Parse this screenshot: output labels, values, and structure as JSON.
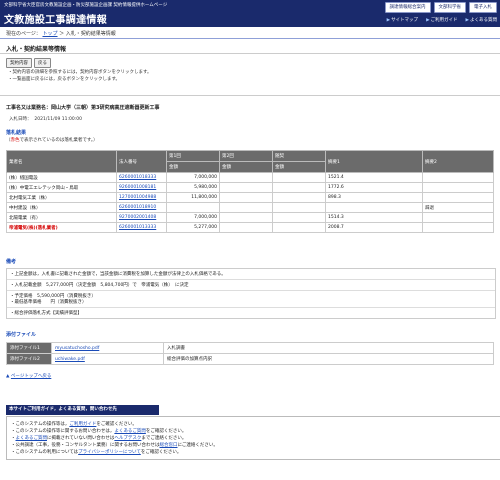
{
  "header": {
    "subtitle": "文部科学省大臣官房文教施設企画・防災部施設企画課 契約情報提供ホームページ",
    "title": "文教施設工事調達情報",
    "buttons": [
      "調達情報総合案内",
      "文部科学省",
      "電子入札"
    ],
    "links": [
      "サイトマップ",
      "ご利用ガイド",
      "よくある質問"
    ]
  },
  "breadcrumb": {
    "prefix": "現在のページ：",
    "top": "トップ",
    "sep1": "＞",
    "current": "入札・契約結果等情報"
  },
  "page_title": "入札・契約結果等情報",
  "controls": {
    "detail_btn": "契約内容",
    "return_btn": "戻る"
  },
  "notes": [
    "・契約内容の詳細を参照するには，契約内容ボタンをクリックします。",
    "・一覧画面に戻るには，戻るボタンをクリックします。"
  ],
  "work": {
    "name_label": "工事名又は業務名：",
    "name": "岡山大学（三朝）第3研究病高圧遮断器更新工事",
    "date_label": "入札日時：",
    "date": "2021/11/09 11:00:00"
  },
  "results": {
    "title": "落札結果",
    "legend_pre": "（",
    "legend_red": "赤色",
    "legend_post": "で表示されているのは落札業者です。）",
    "headers": [
      "業者名",
      "法人番号",
      "第1回",
      "第2回",
      "随契",
      "摘要1",
      "摘要2"
    ],
    "subheaders": [
      "金額",
      "金額",
      "金額"
    ],
    "rows": [
      {
        "name": "(株）楢国電設",
        "corp": "6260001018333",
        "r1": "7,000,000",
        "r2": "",
        "rz": "",
        "m1": "1521.4",
        "m2": "",
        "win": false
      },
      {
        "name": "(株）中電工エレテック岡山・鳥取",
        "corp": "9260001008181",
        "r1": "5,980,000",
        "r2": "",
        "rz": "",
        "m1": "1772.6",
        "m2": "",
        "win": false
      },
      {
        "name": "北村電気工業（株）",
        "corp": "1270001004988",
        "r1": "11,800,000",
        "r2": "",
        "rz": "",
        "m1": "898.3",
        "m2": "",
        "win": false
      },
      {
        "name": "中村建設（株）",
        "corp": "6260001018910",
        "r1": "",
        "r2": "",
        "rz": "",
        "m1": "",
        "m2": "辞退",
        "win": false
      },
      {
        "name": "北陽電業（有）",
        "corp": "9270002001408",
        "r1": "7,000,000",
        "r2": "",
        "rz": "",
        "m1": "1514.3",
        "m2": "",
        "win": false
      },
      {
        "name": "帝浦電気(株)(落札業者)",
        "corp": "6260001013333",
        "r1": "5,277,000",
        "r2": "",
        "rz": "",
        "m1": "2008.7",
        "m2": "",
        "win": true
      }
    ]
  },
  "remarks": {
    "title": "備考",
    "lines": [
      "・上記金額は，入札書に記載された金額で，当該金額に消費税を加算した金額が法律上の入札価格である。",
      "・入札記載金額　5,277,000円（決定金額　5,804,700円）で　帝浦電気（株）　に決定",
      "・予定価格　5,590,000円（消費税抜き）\n・最低基準価格　　円（消費税抜き）",
      "・総合評価落札方式【実績評価型】"
    ]
  },
  "files": {
    "title": "添付ファイル",
    "rows": [
      {
        "label": "添付ファイル1",
        "file": "myusatuchosho.pdf",
        "desc": "入札調書"
      },
      {
        "label": "添付ファイル2",
        "file": "uchiwake.pdf",
        "desc": "総合評価の加算点内訳"
      }
    ]
  },
  "page_top": "ページトップへ戻る",
  "footer": {
    "bar": "本サイトご利用ガイド，よくある質問，問い合わせ先",
    "lines": [
      {
        "pre": "このシステムの操作等は，",
        "link": "ご利用ガイド",
        "post": "をご確認ください。"
      },
      {
        "pre": "このシステムの操作等に関するお問い合わせは，",
        "link": "よくあるご質問",
        "post": "をご確認ください。"
      },
      {
        "pre": "",
        "link": "よくあるご質問",
        "post": "に掲載されていない問い合わせは",
        "link2": "ヘルプデスク",
        "post2": "までご連絡ください。"
      },
      {
        "pre": "公共調達（工事，役務・コンサルタント業務）に関するお問い合わせは",
        "link": "総合窓口",
        "post": "にご連絡ください。"
      },
      {
        "pre": "このシステムの利用については",
        "link": "プライバシーポリシーについて",
        "post": "をご確認ください。"
      }
    ]
  }
}
